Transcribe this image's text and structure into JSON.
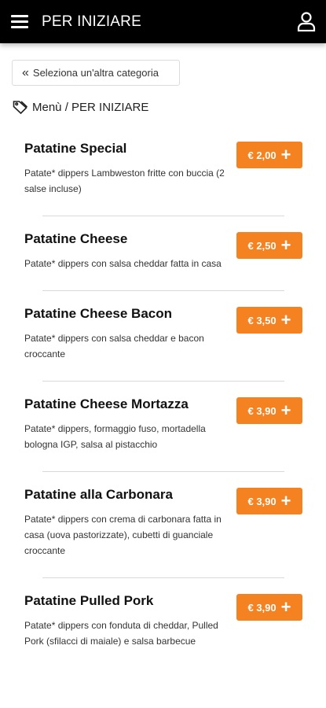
{
  "header": {
    "title": "PER INIZIARE"
  },
  "back_button": {
    "label": "Seleziona un'altra categoria",
    "chevron": "«"
  },
  "breadcrumb": {
    "text": "Menù / PER INIZIARE"
  },
  "accent_color": "#f58220",
  "items": [
    {
      "name": "Patatine Special",
      "description": "Patate* dippers Lambweston fritte con buccia (2 salse incluse)",
      "price": "€ 2,00"
    },
    {
      "name": "Patatine Cheese",
      "description": "Patate* dippers con salsa cheddar fatta in casa",
      "price": "€ 2,50"
    },
    {
      "name": "Patatine Cheese Bacon",
      "description": "Patate* dippers con salsa cheddar e bacon croccante",
      "price": "€ 3,50"
    },
    {
      "name": "Patatine Cheese Mortazza",
      "description": "Patate* dippers, formaggio fuso, mortadella bologna IGP, salsa al pistacchio",
      "price": "€ 3,90"
    },
    {
      "name": "Patatine alla Carbonara",
      "description": "Patate* dippers con crema di carbonara fatta in casa (uova pastorizzate), cubetti di guanciale croccante",
      "price": "€ 3,90"
    },
    {
      "name": "Patatine Pulled Pork",
      "description": "Patate* dippers con fonduta di cheddar, Pulled Pork (sfilacci di maiale) e salsa barbecue",
      "price": "€ 3,90"
    }
  ]
}
